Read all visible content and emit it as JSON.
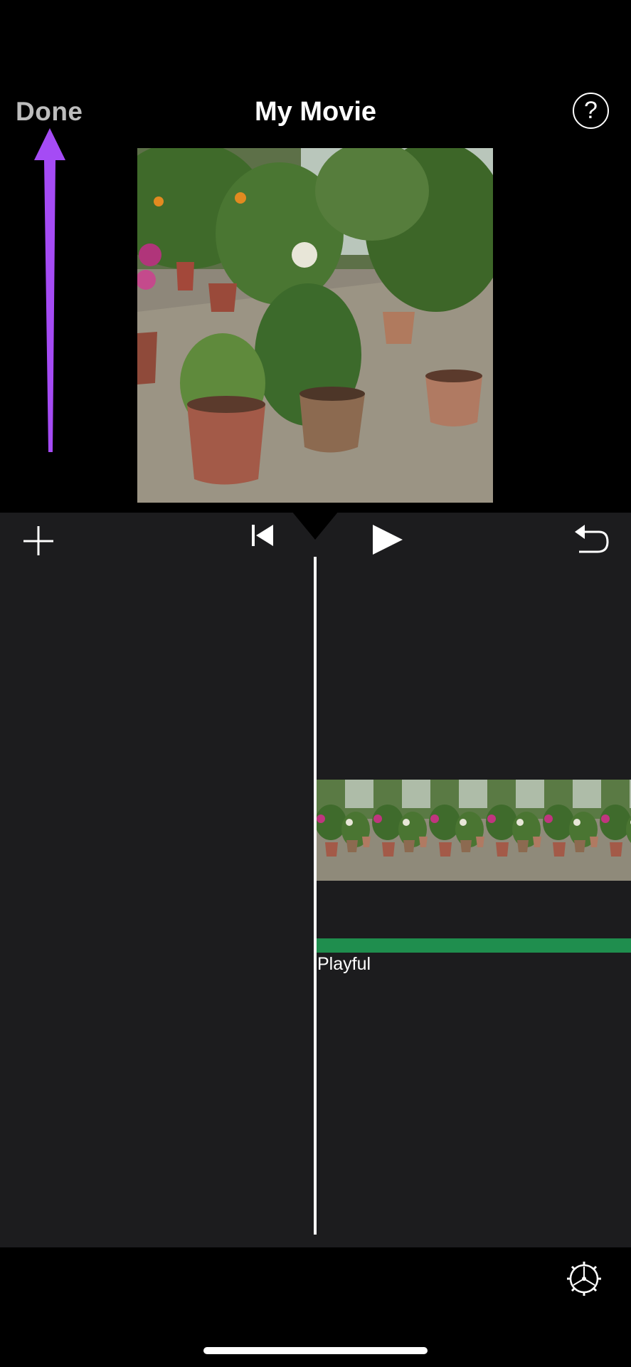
{
  "header": {
    "done_label": "Done",
    "title": "My Movie",
    "help_label": "?"
  },
  "toolbar": {
    "add_icon": "plus-icon",
    "rewind_icon": "skip-to-start-icon",
    "play_icon": "play-icon",
    "undo_icon": "undo-icon"
  },
  "timeline": {
    "music_track_label": "Playful",
    "music_track_color": "#1f8e4e"
  },
  "footer": {
    "settings_icon": "gear-icon"
  },
  "colors": {
    "annotation_arrow": "#a54bf5",
    "done_text": "#bdbdbd",
    "panel_bg": "#1c1c1e"
  }
}
